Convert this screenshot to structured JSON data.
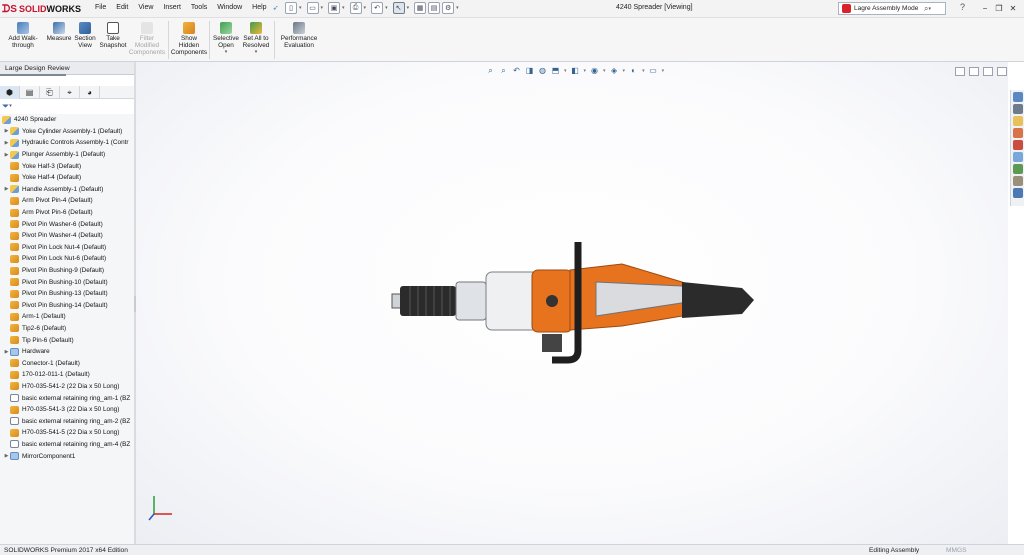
{
  "menus": [
    "File",
    "Edit",
    "View",
    "Insert",
    "Tools",
    "Window",
    "Help"
  ],
  "window": {
    "title": "4240 Spreader [Viewing]"
  },
  "search": {
    "value": "Lagre Assembly Mode",
    "help": "?"
  },
  "ribbon": {
    "walk": "Add Walk-through",
    "measure": "Measure",
    "section": "Section View",
    "snapshot": "Take Snapshot",
    "filter": "Filter Modified Components",
    "show_hidden": "Show Hidden Components",
    "selective": "Selective Open",
    "set_all": "Set All to Resolved",
    "perf": "Performance Evaluation"
  },
  "panel_title": "Large Design Review",
  "tree_root": "4240 Spreader",
  "tree": [
    {
      "label": "Yoke Cylinder Assembly-1 (Default)",
      "kind": "asm",
      "expand": true
    },
    {
      "label": "Hydraulic Controls Assembly-1 (Contr",
      "kind": "asm",
      "expand": true
    },
    {
      "label": "Plunger Assembly-1 (Default)",
      "kind": "asm",
      "expand": true
    },
    {
      "label": "Yoke Half-3 (Default)",
      "kind": "part",
      "expand": false
    },
    {
      "label": "Yoke Half-4 (Default)",
      "kind": "part",
      "expand": false
    },
    {
      "label": "Handle Assembly-1 (Default)",
      "kind": "asm",
      "expand": true
    },
    {
      "label": "Arm Pivot Pin-4 (Default)",
      "kind": "part",
      "expand": false
    },
    {
      "label": "Arm Pivot Pin-6 (Default)",
      "kind": "part",
      "expand": false
    },
    {
      "label": "Pivot Pin Washer-6 (Default)",
      "kind": "part",
      "expand": false
    },
    {
      "label": "Pivot Pin Washer-4 (Default)",
      "kind": "part",
      "expand": false
    },
    {
      "label": "Pivot Pin Lock Nut-4 (Default)",
      "kind": "part",
      "expand": false
    },
    {
      "label": "Pivot Pin Lock Nut-6 (Default)",
      "kind": "part",
      "expand": false
    },
    {
      "label": "Pivot Pin Bushing-9 (Default)",
      "kind": "part",
      "expand": false
    },
    {
      "label": "Pivot Pin Bushing-10 (Default)",
      "kind": "part",
      "expand": false
    },
    {
      "label": "Pivot Pin Bushing-13 (Default)",
      "kind": "part",
      "expand": false
    },
    {
      "label": "Pivot Pin Bushing-14 (Default)",
      "kind": "part",
      "expand": false
    },
    {
      "label": "Arm-1 (Default)",
      "kind": "part",
      "expand": false
    },
    {
      "label": "Tip2-6 (Default)",
      "kind": "part",
      "expand": false
    },
    {
      "label": "Tip Pin-6 (Default)",
      "kind": "part",
      "expand": false
    },
    {
      "label": "Hardware",
      "kind": "folder",
      "expand": true
    },
    {
      "label": "Conector-1 (Default)",
      "kind": "part",
      "expand": false
    },
    {
      "label": "170-012-011-1 (Default)",
      "kind": "part",
      "expand": false
    },
    {
      "label": "H70-035-541-2 (22 Dia x 50 Long)",
      "kind": "part",
      "expand": false
    },
    {
      "label": "basic external retaining ring_am-1 (BZ",
      "kind": "ring",
      "expand": false
    },
    {
      "label": "H70-035-541-3 (22 Dia x 50 Long)",
      "kind": "part",
      "expand": false
    },
    {
      "label": "basic external retaining ring_am-2 (BZ",
      "kind": "ring",
      "expand": false
    },
    {
      "label": "H70-035-541-5 (22 Dia x 50 Long)",
      "kind": "part",
      "expand": false
    },
    {
      "label": "basic external retaining ring_am-4 (BZ",
      "kind": "ring",
      "expand": false
    },
    {
      "label": "MirrorComponent1",
      "kind": "folder",
      "expand": true
    }
  ],
  "status": {
    "left": "SOLIDWORKS Premium 2017 x64 Edition",
    "mode": "Editing Assembly",
    "units": "MMGS"
  },
  "logo": {
    "solid": "SOLID",
    "works": "WORKS"
  },
  "colors": {
    "accent": "#c8102e",
    "orange": "#e8731f",
    "selection": "#dbe6f3"
  }
}
